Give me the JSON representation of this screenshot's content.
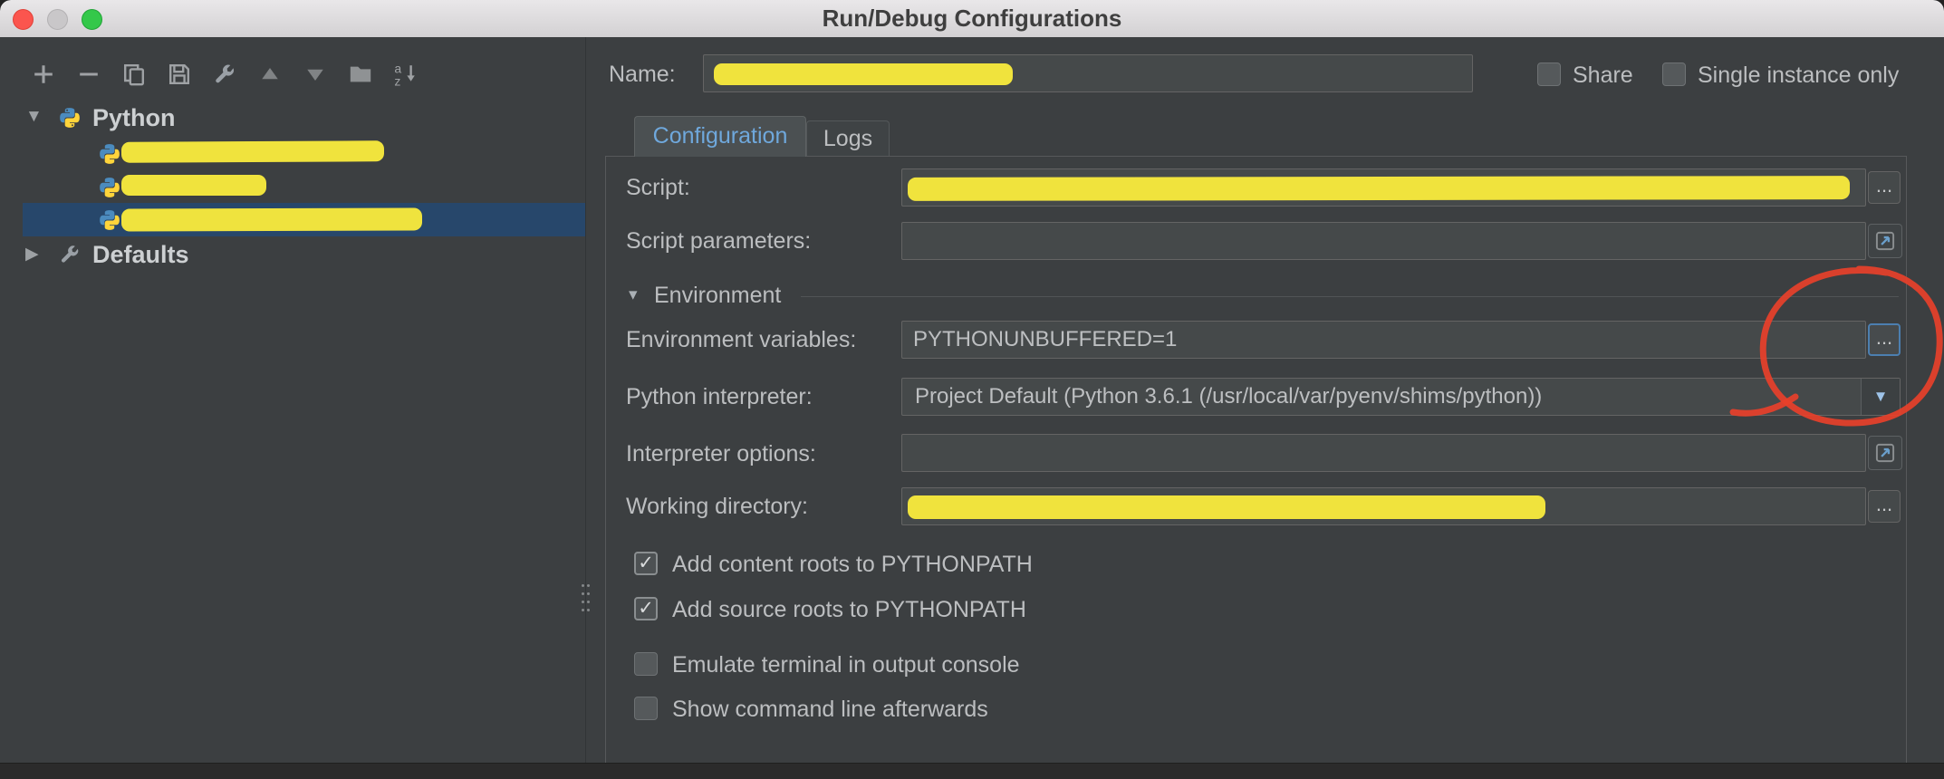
{
  "window": {
    "title": "Run/Debug Configurations"
  },
  "toolbar": {
    "icons": [
      "add",
      "remove",
      "copy-configuration",
      "save-configuration",
      "edit-defaults",
      "move-up",
      "move-down",
      "new-folder",
      "sort-configurations"
    ]
  },
  "sidebar": {
    "root_label": "Python",
    "defaults_label": "Defaults",
    "redacted_item_count": 3
  },
  "header": {
    "name_label": "Name:",
    "share_label": "Share",
    "single_label": "Single instance only"
  },
  "tabs": {
    "items": [
      {
        "label": "Configuration",
        "selected": true
      },
      {
        "label": "Logs",
        "selected": false
      }
    ]
  },
  "form": {
    "script_label": "Script:",
    "script_params_label": "Script parameters:",
    "env_section_label": "Environment",
    "env_vars_label": "Environment variables:",
    "env_vars_value": "PYTHONUNBUFFERED=1",
    "interpreter_label": "Python interpreter:",
    "interpreter_value": "Project Default (Python 3.6.1 (/usr/local/var/pyenv/shims/python))",
    "interpreter_options_label": "Interpreter options:",
    "working_dir_label": "Working directory:",
    "browse_label": "...",
    "checkboxes": [
      {
        "label": "Add content roots to PYTHONPATH",
        "checked": true,
        "glyph": "✓"
      },
      {
        "label": "Add source roots to PYTHONPATH",
        "checked": true,
        "glyph": "✓"
      },
      {
        "label": "Emulate terminal in output console",
        "checked": false,
        "glyph": ""
      },
      {
        "label": "Show command line afterwards",
        "checked": false,
        "glyph": ""
      }
    ]
  },
  "glyphs": {
    "tree_expanded": "▼",
    "tree_collapsed": "▶",
    "section_arrow": "▾",
    "combo_arrow": "▼"
  },
  "annotations": {
    "highlight_color": "#f6e83d",
    "circle_color": "#e8402a"
  },
  "colors": {
    "background": "#3c3f41",
    "field_background": "#45494a",
    "field_border": "#646464",
    "text": "#bcbec0",
    "selection": "#27476b",
    "tab_selected_text": "#6fa8dc",
    "python_blue": "#4b8bbe",
    "python_yellow": "#ffd43b"
  }
}
